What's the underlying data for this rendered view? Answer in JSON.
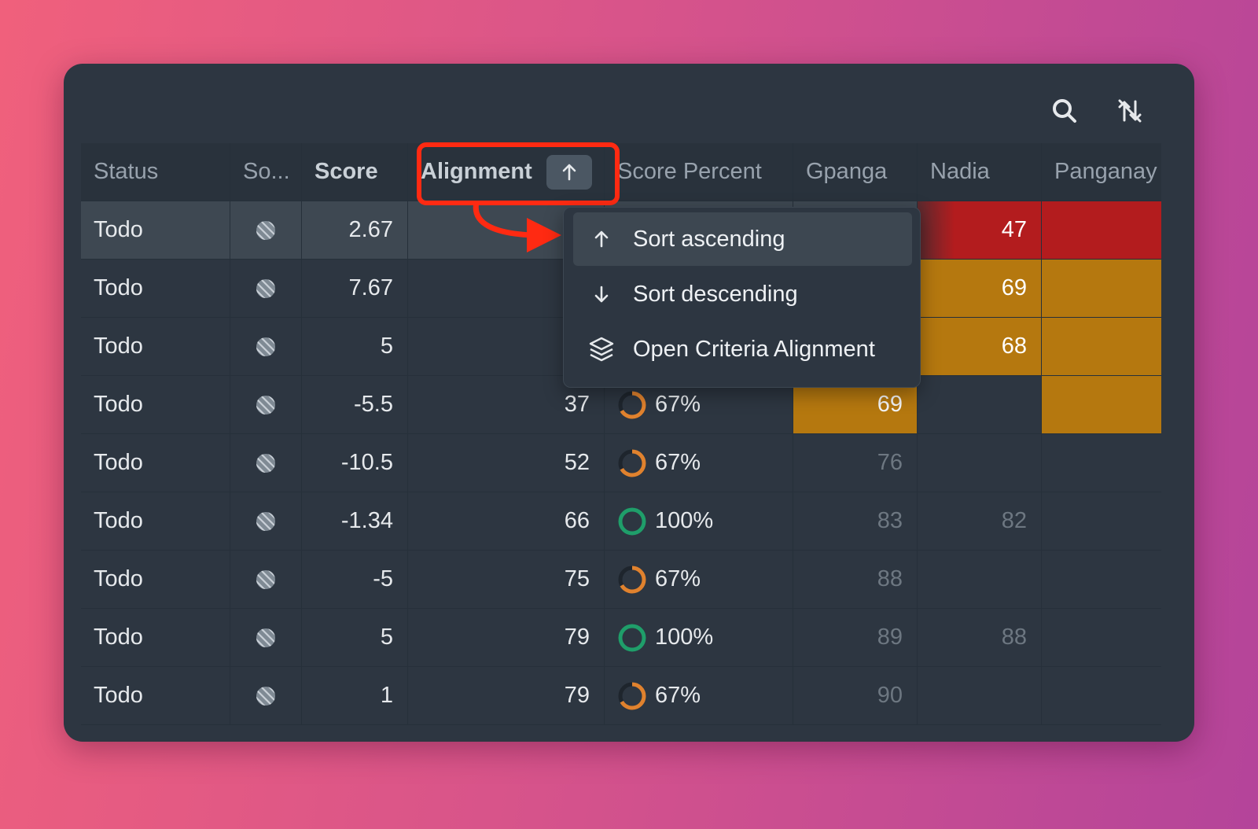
{
  "colors": {
    "red_cell": "#b31c1e",
    "amber_cell": "#b5780f",
    "ring_orange": "#e0822e",
    "ring_green": "#1f9e6a",
    "highlight": "#ff2a12"
  },
  "toolbar": {
    "icons": [
      "search-icon",
      "sort-off-icon"
    ]
  },
  "table": {
    "headers": {
      "status": "Status",
      "source": "So...",
      "score": "Score",
      "alignment": "Alignment",
      "score_percent": "Score Percent",
      "gpanga": "Gpanga",
      "nadia": "Nadia",
      "panganay": "Panganay"
    },
    "rows": [
      {
        "status": "Todo",
        "score": "2.67",
        "alignment": "",
        "percent": "",
        "gpanga": "",
        "nadia": "47"
      },
      {
        "status": "Todo",
        "score": "7.67",
        "alignment": "",
        "percent": "",
        "gpanga": "",
        "nadia": "69"
      },
      {
        "status": "Todo",
        "score": "5",
        "alignment": "",
        "percent": "",
        "gpanga": "",
        "nadia": "68"
      },
      {
        "status": "Todo",
        "score": "-5.5",
        "alignment": "37",
        "percent": "67%",
        "gpanga": "69",
        "nadia": ""
      },
      {
        "status": "Todo",
        "score": "-10.5",
        "alignment": "52",
        "percent": "67%",
        "gpanga": "76",
        "nadia": ""
      },
      {
        "status": "Todo",
        "score": "-1.34",
        "alignment": "66",
        "percent": "100%",
        "gpanga": "83",
        "nadia": "82"
      },
      {
        "status": "Todo",
        "score": "-5",
        "alignment": "75",
        "percent": "67%",
        "gpanga": "88",
        "nadia": ""
      },
      {
        "status": "Todo",
        "score": "5",
        "alignment": "79",
        "percent": "100%",
        "gpanga": "89",
        "nadia": "88"
      },
      {
        "status": "Todo",
        "score": "1",
        "alignment": "79",
        "percent": "67%",
        "gpanga": "90",
        "nadia": ""
      }
    ]
  },
  "menu": {
    "sort_ascending": "Sort ascending",
    "sort_descending": "Sort descending",
    "open_criteria": "Open Criteria Alignment"
  }
}
